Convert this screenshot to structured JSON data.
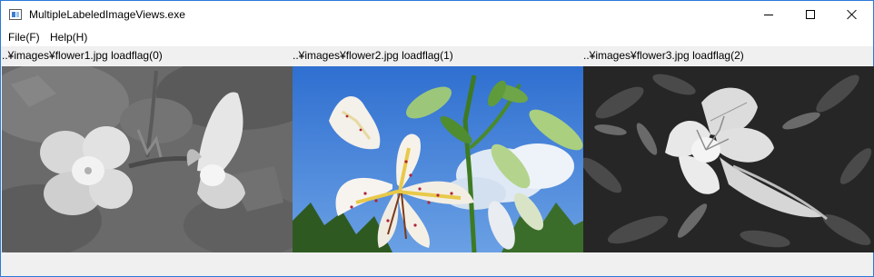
{
  "window": {
    "title": "MultipleLabeledImageViews.exe"
  },
  "menu": {
    "file": "File(F)",
    "help": "Help(H)"
  },
  "panels": [
    {
      "label": "..¥images¥flower1.jpg loadflag(0)",
      "image": "white-evening-primrose-grayscale"
    },
    {
      "label": "..¥images¥flower2.jpg loadflag(1)",
      "image": "spotted-lily-color"
    },
    {
      "label": "..¥images¥flower3.jpg loadflag(2)",
      "image": "white-lily-grayscale"
    }
  ],
  "colors": {
    "window_border": "#2b79d8",
    "client_background": "#f0f0f0",
    "titlebar_background": "#ffffff",
    "sky": "#3f7fd6",
    "leaf": "#4a8a2a"
  },
  "icons": {
    "app": "app-window-icon",
    "minimize": "minimize-icon",
    "maximize": "maximize-icon",
    "close": "close-icon"
  }
}
